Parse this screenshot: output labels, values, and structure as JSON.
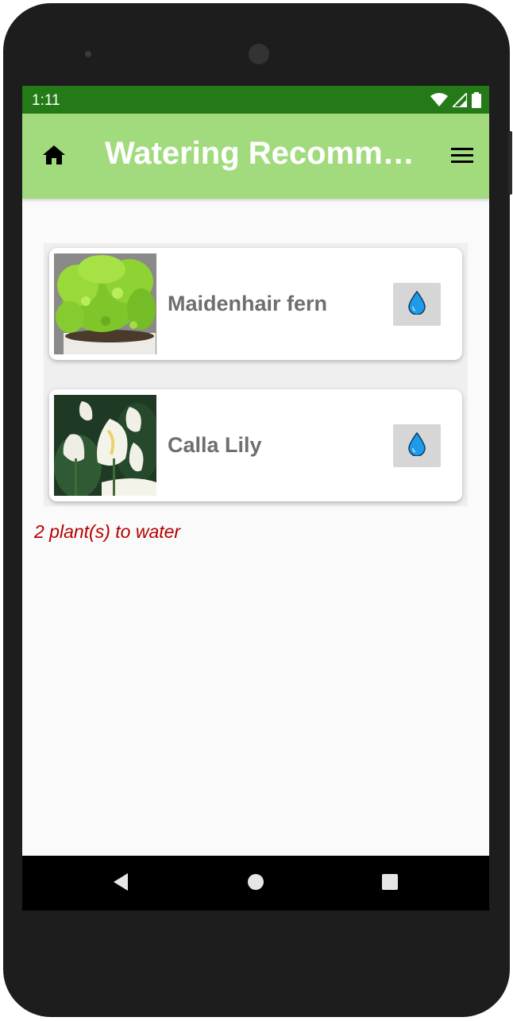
{
  "status_bar": {
    "time": "1:11",
    "icons": [
      "wifi-icon",
      "signal-icon",
      "battery-icon"
    ]
  },
  "app_bar": {
    "title": "Watering Recomm…",
    "home_icon": "home-icon",
    "menu_icon": "menu-icon",
    "background": "#a2db7e"
  },
  "plants": [
    {
      "name": "Maidenhair fern",
      "photo": "maidenhair-fern-photo",
      "action_icon": "water-drop-icon"
    },
    {
      "name": "Calla Lily",
      "photo": "calla-lily-photo",
      "action_icon": "water-drop-icon"
    }
  ],
  "summary": {
    "text": "2 plant(s) to water",
    "color": "#b50000"
  },
  "nav_bar": {
    "buttons": [
      "back-icon",
      "home-circle-icon",
      "recents-icon"
    ]
  },
  "colors": {
    "status_bar": "#257a18",
    "accent_green": "#a2db7e",
    "water_drop": "#1e9be8"
  }
}
